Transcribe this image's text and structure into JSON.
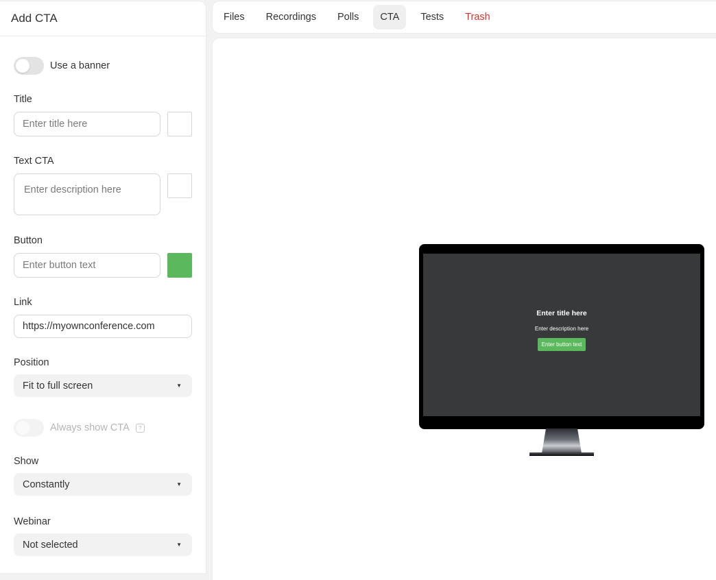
{
  "panel": {
    "title": "Add CTA",
    "use_banner_label": "Use a banner",
    "title_label": "Title",
    "title_placeholder": "Enter title here",
    "text_cta_label": "Text CTA",
    "text_cta_placeholder": "Enter description here",
    "button_label": "Button",
    "button_placeholder": "Enter button text",
    "button_color": "#5cb85c",
    "link_label": "Link",
    "link_value": "https://myownconference.com",
    "position_label": "Position",
    "position_value": "Fit to full screen",
    "always_show_label": "Always show CTA",
    "help_icon": "?",
    "show_label": "Show",
    "show_value": "Constantly",
    "webinar_label": "Webinar",
    "webinar_value": "Not selected",
    "caret": "▼"
  },
  "tabs": [
    {
      "label": "Files"
    },
    {
      "label": "Recordings"
    },
    {
      "label": "Polls"
    },
    {
      "label": "CTA",
      "active": true
    },
    {
      "label": "Tests"
    },
    {
      "label": "Trash",
      "color": "#e02e2e"
    }
  ],
  "preview": {
    "title": "Enter title here",
    "description": "Enter description here",
    "button_text": "Enter button text"
  }
}
